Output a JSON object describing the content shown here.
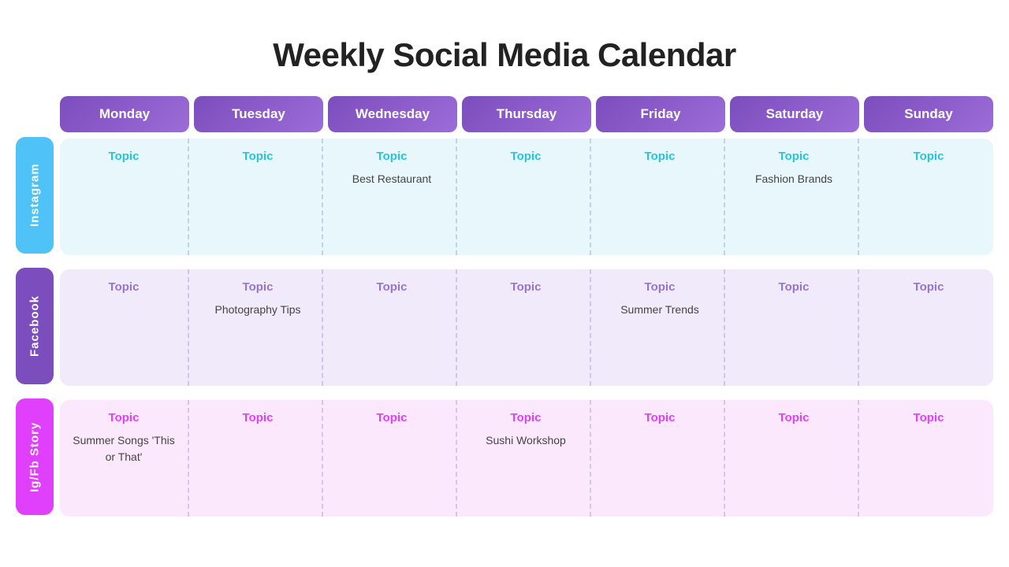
{
  "title": "Weekly Social Media Calendar",
  "days": [
    "Monday",
    "Tuesday",
    "Wednesday",
    "Thursday",
    "Friday",
    "Saturday",
    "Sunday"
  ],
  "rows": [
    {
      "id": "instagram",
      "label": "Instagram",
      "cells": [
        {
          "topic": "Topic",
          "content": ""
        },
        {
          "topic": "Topic",
          "content": ""
        },
        {
          "topic": "Topic",
          "content": "Best Restaurant"
        },
        {
          "topic": "Topic",
          "content": ""
        },
        {
          "topic": "Topic",
          "content": ""
        },
        {
          "topic": "Topic",
          "content": "Fashion Brands"
        },
        {
          "topic": "Topic",
          "content": ""
        }
      ]
    },
    {
      "id": "facebook",
      "label": "Facebook",
      "cells": [
        {
          "topic": "Topic",
          "content": ""
        },
        {
          "topic": "Topic",
          "content": "Photography Tips"
        },
        {
          "topic": "Topic",
          "content": ""
        },
        {
          "topic": "Topic",
          "content": ""
        },
        {
          "topic": "Topic",
          "content": "Summer Trends"
        },
        {
          "topic": "Topic",
          "content": ""
        },
        {
          "topic": "Topic",
          "content": ""
        }
      ]
    },
    {
      "id": "igfb",
      "label": "Ig/Fb Story",
      "cells": [
        {
          "topic": "Topic",
          "content": "Summer Songs\n'This or That'"
        },
        {
          "topic": "Topic",
          "content": ""
        },
        {
          "topic": "Topic",
          "content": ""
        },
        {
          "topic": "Topic",
          "content": "Sushi Workshop"
        },
        {
          "topic": "Topic",
          "content": ""
        },
        {
          "topic": "Topic",
          "content": ""
        },
        {
          "topic": "Topic",
          "content": ""
        }
      ]
    }
  ]
}
